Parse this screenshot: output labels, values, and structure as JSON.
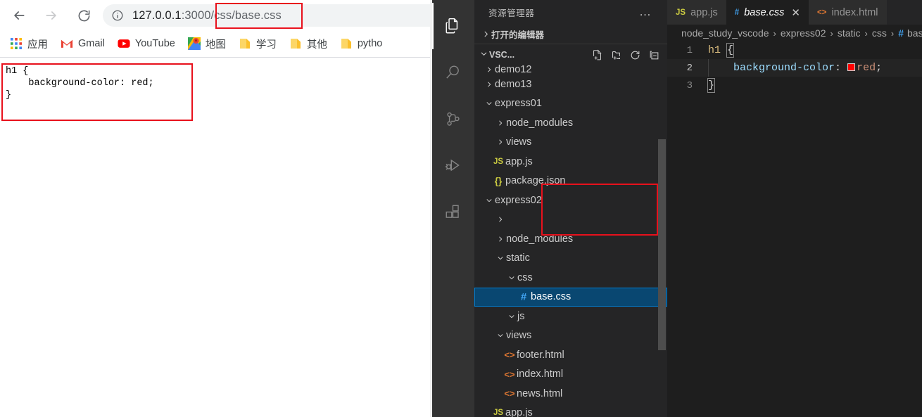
{
  "browser": {
    "nav": {
      "back_label": "Back",
      "forward_label": "Forward",
      "reload_label": "Reload"
    },
    "omnibox": {
      "info_label": "Site information",
      "url_host": "127.0.0.1",
      "url_port": ":3000",
      "url_path": "/css/base.css",
      "url_full": "127.0.0.1:3000/css/base.css"
    },
    "bookmarks": [
      {
        "label": "应用",
        "icon": "apps-grid-icon"
      },
      {
        "label": "Gmail",
        "icon": "gmail-icon"
      },
      {
        "label": "YouTube",
        "icon": "youtube-icon"
      },
      {
        "label": "地图",
        "icon": "maps-icon"
      },
      {
        "label": "学习",
        "icon": "folder-icon"
      },
      {
        "label": "其他",
        "icon": "folder-icon"
      },
      {
        "label": "pytho",
        "icon": "folder-icon"
      }
    ],
    "page_content": "h1 {\n    background-color: red;\n}",
    "annotation_color": "#e8111c"
  },
  "vscode": {
    "activity_bar": [
      {
        "name": "explorer",
        "icon": "files-icon",
        "active": true
      },
      {
        "name": "search",
        "icon": "search-icon",
        "active": false
      },
      {
        "name": "source-control",
        "icon": "source-control-icon",
        "active": false
      },
      {
        "name": "run-debug",
        "icon": "run-debug-icon",
        "active": false
      },
      {
        "name": "extensions",
        "icon": "extensions-icon",
        "active": false
      }
    ],
    "sidebar": {
      "title": "资源管理器",
      "more_actions": "…",
      "open_editors_label": "打开的编辑器",
      "root_label": "VSC...",
      "actions": [
        {
          "name": "new-file",
          "icon": "new-file-icon"
        },
        {
          "name": "new-folder",
          "icon": "new-folder-icon"
        },
        {
          "name": "refresh",
          "icon": "refresh-icon"
        },
        {
          "name": "collapse-all",
          "icon": "collapse-all-icon"
        }
      ],
      "tree": [
        {
          "label": "demo12",
          "depth": 0,
          "type": "folder",
          "state": "collapsed",
          "clipped": true
        },
        {
          "label": "demo13",
          "depth": 0,
          "type": "folder",
          "state": "collapsed"
        },
        {
          "label": "express01",
          "depth": 0,
          "type": "folder",
          "state": "expanded"
        },
        {
          "label": "node_modules",
          "depth": 1,
          "type": "folder",
          "state": "collapsed"
        },
        {
          "label": "views",
          "depth": 1,
          "type": "folder",
          "state": "collapsed"
        },
        {
          "label": "app.js",
          "depth": 1,
          "type": "js"
        },
        {
          "label": "package.json",
          "depth": 1,
          "type": "json"
        },
        {
          "label": "express02",
          "depth": 0,
          "type": "folder",
          "state": "expanded"
        },
        {
          "label": "",
          "depth": 1,
          "type": "folder",
          "state": "collapsed"
        },
        {
          "label": "node_modules",
          "depth": 1,
          "type": "folder",
          "state": "collapsed"
        },
        {
          "label": "static",
          "depth": 1,
          "type": "folder",
          "state": "expanded"
        },
        {
          "label": "css",
          "depth": 2,
          "type": "folder",
          "state": "expanded"
        },
        {
          "label": "base.css",
          "depth": 3,
          "type": "css",
          "selected": true
        },
        {
          "label": "js",
          "depth": 2,
          "type": "folder",
          "state": "expanded"
        },
        {
          "label": "views",
          "depth": 1,
          "type": "folder",
          "state": "expanded"
        },
        {
          "label": "footer.html",
          "depth": 2,
          "type": "html"
        },
        {
          "label": "index.html",
          "depth": 2,
          "type": "html"
        },
        {
          "label": "news.html",
          "depth": 2,
          "type": "html"
        },
        {
          "label": "app.js",
          "depth": 1,
          "type": "js",
          "clipped": true
        }
      ]
    },
    "tabs": [
      {
        "label": "app.js",
        "icon": "js-file-icon",
        "active": false,
        "closable": false
      },
      {
        "label": "base.css",
        "icon": "css-file-icon",
        "active": true,
        "closable": true,
        "close_label": "✕"
      },
      {
        "label": "index.html",
        "icon": "html-file-icon",
        "active": false,
        "closable": false
      }
    ],
    "breadcrumb": {
      "separator": "›",
      "items": [
        "node_study_vscode",
        "express02",
        "static",
        "css"
      ],
      "file": "bas",
      "file_icon": "#"
    },
    "editor": {
      "lines": [
        {
          "number": "1",
          "current": false
        },
        {
          "number": "2",
          "current": true
        },
        {
          "number": "3",
          "current": false
        }
      ],
      "code": {
        "l1_selector": "h1",
        "l1_brace": "{",
        "l2_property": "background-color",
        "l2_colon": ":",
        "l2_value": "red",
        "l2_semicolon": ";",
        "l3_brace": "}",
        "swatch_color": "#ff0000"
      }
    }
  }
}
